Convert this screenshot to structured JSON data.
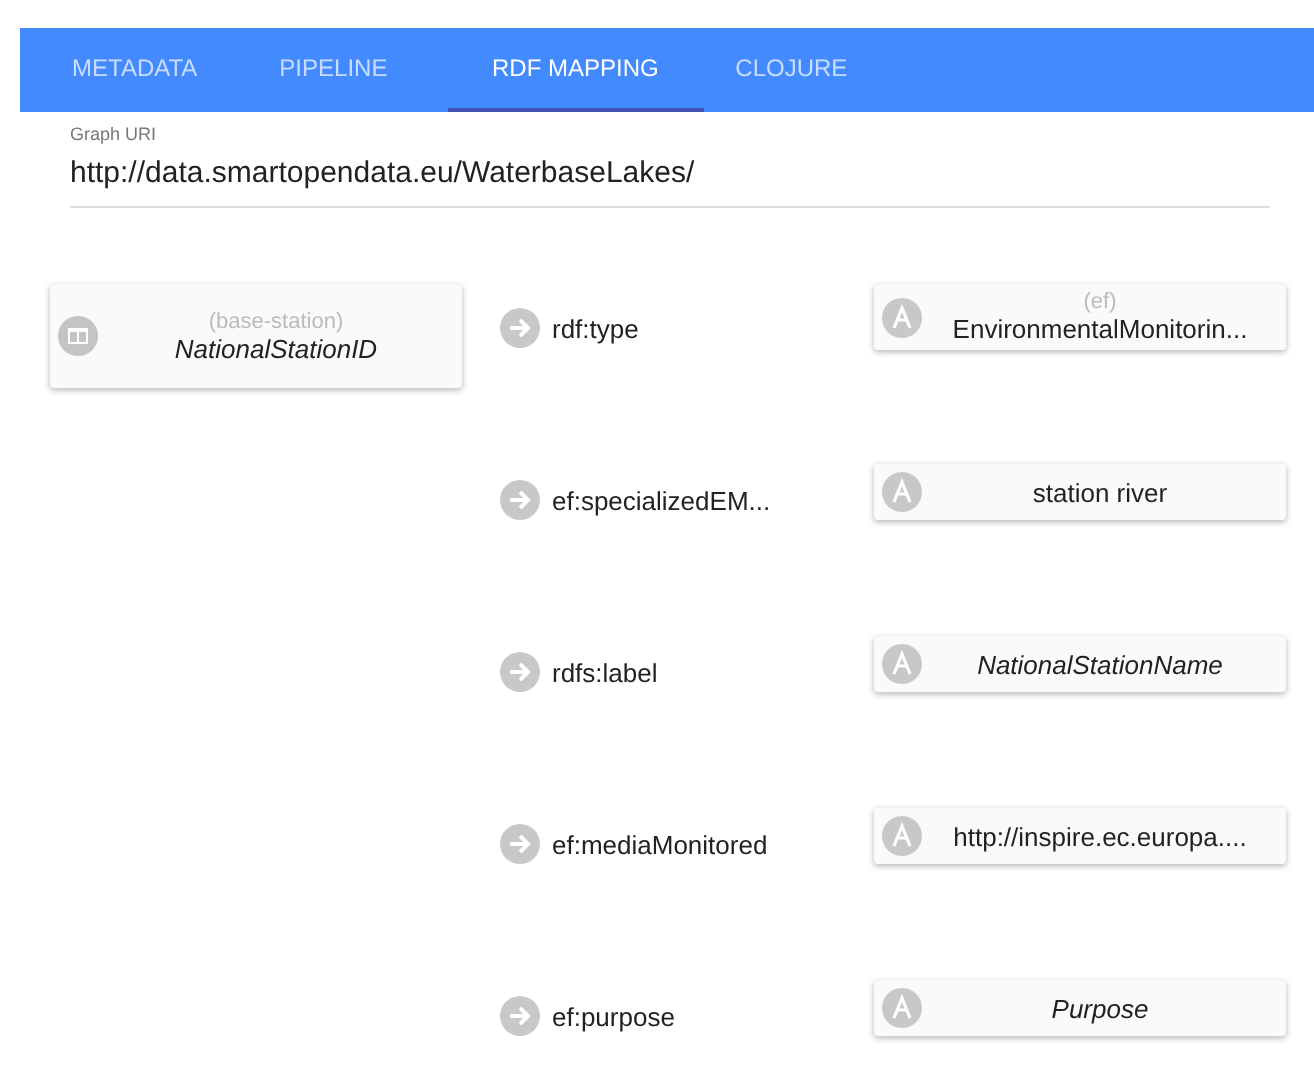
{
  "tabs": [
    {
      "label": "METADATA",
      "selected": false
    },
    {
      "label": "PIPELINE",
      "selected": false
    },
    {
      "label": "RDF MAPPING",
      "selected": true
    },
    {
      "label": "CLOJURE",
      "selected": false
    }
  ],
  "graph_uri": {
    "label": "Graph URI",
    "value": "http://data.smartopendata.eu/WaterbaseLakes/"
  },
  "subject": {
    "prefix": "(base-station)",
    "name": "NationalStationID"
  },
  "properties": [
    {
      "predicate": "rdf:type",
      "object": {
        "kind": "constant",
        "prefix": "(ef)",
        "value": "EnvironmentalMonitorin..."
      }
    },
    {
      "predicate": "ef:specializedEM...",
      "object": {
        "kind": "constant",
        "value": "station river"
      }
    },
    {
      "predicate": "rdfs:label",
      "object": {
        "kind": "column",
        "value": "NationalStationName"
      }
    },
    {
      "predicate": "ef:mediaMonitored",
      "object": {
        "kind": "constant",
        "value": "http://inspire.ec.europa...."
      }
    },
    {
      "predicate": "ef:purpose",
      "object": {
        "kind": "column",
        "value": "Purpose"
      }
    }
  ]
}
